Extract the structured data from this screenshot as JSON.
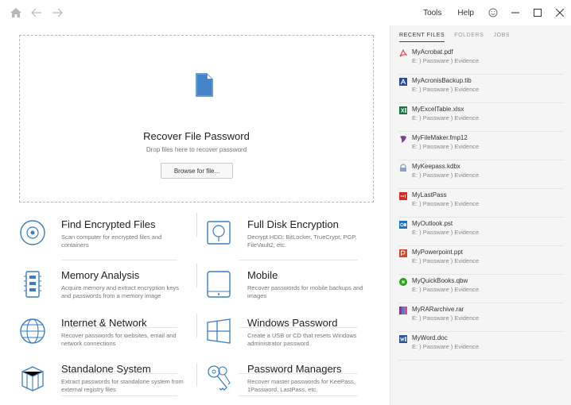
{
  "titlebar": {
    "menu": [
      {
        "label": "Tools"
      },
      {
        "label": "Help"
      }
    ],
    "icons": [
      "home-icon",
      "back-arrow-icon",
      "forward-arrow-icon",
      "smiley-icon",
      "minimize-icon",
      "maximize-icon",
      "close-icon"
    ]
  },
  "dropzone": {
    "title": "Recover File Password",
    "subtitle": "Drop files here to recover password",
    "browse_label": "Browse for file...",
    "icon": "file-icon"
  },
  "features": [
    {
      "title": "Find Encrypted Files",
      "desc": "Scan computer for encrypted files and containers",
      "icon": "disc-search-icon"
    },
    {
      "title": "Full Disk Encryption",
      "desc": "Decrypt HDD: BitLocker, TrueCrypt, PGP, FileVault2, etc.",
      "icon": "disk-shield-icon"
    },
    {
      "title": "Memory Analysis",
      "desc": "Acquire memory and extract encryption keys and passwords from a memory image",
      "icon": "memory-chip-icon"
    },
    {
      "title": "Mobile",
      "desc": "Recover passwords for mobile backups and images",
      "icon": "mobile-phone-icon"
    },
    {
      "title": "Internet & Network",
      "desc": "Recover passwords for websites, email and network connections",
      "icon": "globe-icon"
    },
    {
      "title": "Windows Password",
      "desc": "Create a USB or CD that resets Windows administrator password",
      "icon": "windows-logo-icon"
    },
    {
      "title": "Standalone System",
      "desc": "Extract passwords for standalone system from external registry files",
      "icon": "cube-system-icon"
    },
    {
      "title": "Password Managers",
      "desc": "Recover master passwords for KeePass, 1Password, LastPass, etc.",
      "icon": "keys-icon"
    }
  ],
  "panel": {
    "tabs": [
      {
        "label": "RECENT FILES",
        "active": true
      },
      {
        "label": "FOLDERS",
        "active": false
      },
      {
        "label": "JOBS",
        "active": false
      }
    ],
    "recent": [
      {
        "name": "MyAcrobat.pdf",
        "path": "E: ) Passware ) Evidence",
        "icon": "acrobat-icon",
        "color": "#d9342b"
      },
      {
        "name": "MyAcronisBackup.tib",
        "path": "E: ) Passware ) Evidence",
        "icon": "acronis-icon",
        "color": "#2c4a9a"
      },
      {
        "name": "MyExcelTable.xlsx",
        "path": "E: ) Passware ) Evidence",
        "icon": "excel-icon",
        "color": "#1e7145"
      },
      {
        "name": "MyFileMaker.fmp12",
        "path": "E: ) Passware ) Evidence",
        "icon": "filemaker-icon",
        "color": "#7b3fa0"
      },
      {
        "name": "MyKeepass.kdbx",
        "path": "E: ) Passware ) Evidence",
        "icon": "keepass-icon",
        "color": "#8aa4c8"
      },
      {
        "name": "MyLastPass",
        "path": "E: ) Passware ) Evidence",
        "icon": "lastpass-icon",
        "color": "#d32d27"
      },
      {
        "name": "MyOutlook.pst",
        "path": "E: ) Passware ) Evidence",
        "icon": "outlook-icon",
        "color": "#1a73c9"
      },
      {
        "name": "MyPowerpoint.ppt",
        "path": "E: ) Passware ) Evidence",
        "icon": "powerpoint-icon",
        "color": "#d24726"
      },
      {
        "name": "MyQuickBooks.qbw",
        "path": "E: ) Passware ) Evidence",
        "icon": "quickbooks-icon",
        "color": "#2ca01c"
      },
      {
        "name": "MyRARarchive.rar",
        "path": "E: ) Passware ) Evidence",
        "icon": "rar-icon",
        "color": "#7a3b8c"
      },
      {
        "name": "MyWord.doc",
        "path": "E: ) Passware ) Evidence",
        "icon": "word-icon",
        "color": "#2b5797"
      }
    ]
  },
  "colors": {
    "icon_blue": "#3b7dc4",
    "panel_bg": "#f5f5f5"
  }
}
